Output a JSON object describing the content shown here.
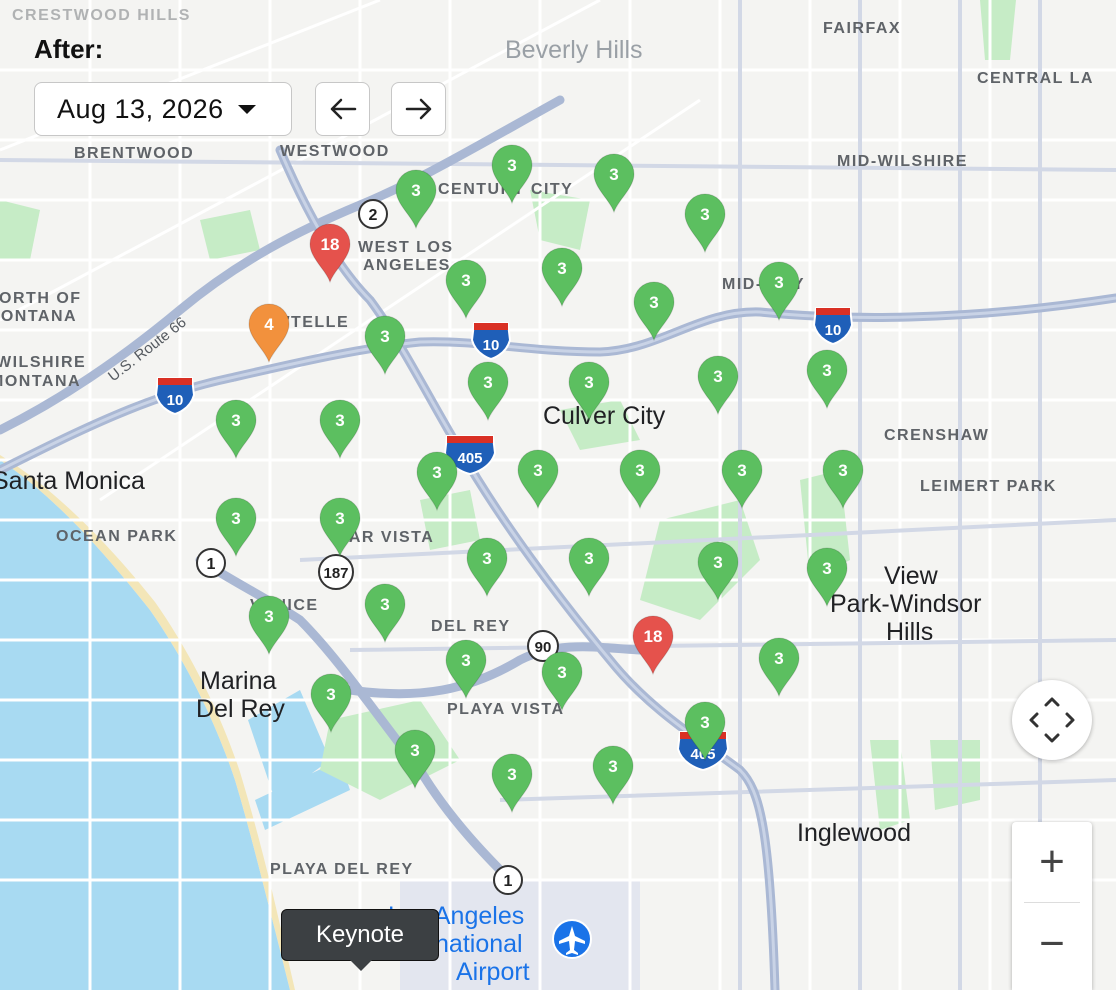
{
  "filter": {
    "label": "After:",
    "date": "Aug 13, 2026",
    "prev_icon": "arrow-left-icon",
    "next_icon": "arrow-right-icon"
  },
  "map": {
    "water_color": "#a8daf2",
    "park_color": "#c6ecc6",
    "road_color": "#aab8d4",
    "neighborhoods": [
      "CRESTWOOD HILLS",
      "FAIRFAX",
      "CENTRAL LA",
      "BRENTWOOD",
      "WESTWOOD",
      "MID-WILSHIRE",
      "WEST LOS",
      "ANGELES",
      "CENTURY CITY",
      "SAWTELLE",
      "MID-CITY",
      "NORTH OF",
      "MONTANA",
      "WILSHIRE",
      "MONTANA",
      "CRENSHAW",
      "LEIMERT PARK",
      "OCEAN PARK",
      "MAR VISTA",
      "VENICE",
      "DEL REY",
      "PLAYA VISTA",
      "PLAYA DEL REY"
    ],
    "cities": [
      "Beverly Hills",
      "Culver City",
      "Santa Monica",
      "View",
      "Park-Windsor",
      "Hills",
      "Marina",
      "Del Rey",
      "Inglewood",
      "Los Angeles",
      "International",
      "Airport"
    ],
    "road_labels": [
      "U.S. Route 66"
    ],
    "shields": [
      "2",
      "10",
      "10",
      "10",
      "405",
      "405",
      "1",
      "187",
      "90",
      "1"
    ]
  },
  "markers": [
    {
      "count": "3",
      "color": "#5cbf60"
    },
    {
      "count": "3",
      "color": "#5cbf60"
    },
    {
      "count": "3",
      "color": "#5cbf60"
    },
    {
      "count": "3",
      "color": "#5cbf60"
    },
    {
      "count": "18",
      "color": "#e5524c"
    },
    {
      "count": "3",
      "color": "#5cbf60"
    },
    {
      "count": "3",
      "color": "#5cbf60"
    },
    {
      "count": "3",
      "color": "#5cbf60"
    },
    {
      "count": "3",
      "color": "#5cbf60"
    },
    {
      "count": "4",
      "color": "#f2913d"
    },
    {
      "count": "3",
      "color": "#5cbf60"
    },
    {
      "count": "3",
      "color": "#5cbf60"
    },
    {
      "count": "3",
      "color": "#5cbf60"
    },
    {
      "count": "3",
      "color": "#5cbf60"
    },
    {
      "count": "3",
      "color": "#5cbf60"
    },
    {
      "count": "3",
      "color": "#5cbf60"
    },
    {
      "count": "3",
      "color": "#5cbf60"
    },
    {
      "count": "3",
      "color": "#5cbf60"
    },
    {
      "count": "3",
      "color": "#5cbf60"
    },
    {
      "count": "3",
      "color": "#5cbf60"
    },
    {
      "count": "3",
      "color": "#5cbf60"
    },
    {
      "count": "3",
      "color": "#5cbf60"
    },
    {
      "count": "3",
      "color": "#5cbf60"
    },
    {
      "count": "3",
      "color": "#5cbf60"
    },
    {
      "count": "3",
      "color": "#5cbf60"
    },
    {
      "count": "3",
      "color": "#5cbf60"
    },
    {
      "count": "3",
      "color": "#5cbf60"
    },
    {
      "count": "3",
      "color": "#5cbf60"
    },
    {
      "count": "3",
      "color": "#5cbf60"
    },
    {
      "count": "3",
      "color": "#5cbf60"
    },
    {
      "count": "18",
      "color": "#e5524c"
    },
    {
      "count": "3",
      "color": "#5cbf60"
    },
    {
      "count": "3",
      "color": "#5cbf60"
    },
    {
      "count": "3",
      "color": "#5cbf60"
    },
    {
      "count": "3",
      "color": "#5cbf60"
    },
    {
      "count": "3",
      "color": "#5cbf60"
    },
    {
      "count": "3",
      "color": "#5cbf60"
    },
    {
      "count": "3",
      "color": "#5cbf60"
    },
    {
      "count": "3",
      "color": "#5cbf60"
    },
    {
      "count": "3",
      "color": "#5cbf60"
    },
    {
      "count": "3",
      "color": "#5cbf60"
    }
  ],
  "controls": {
    "recenter_icon": "recenter-arrows-icon",
    "zoom_in": "+",
    "zoom_out": "−"
  },
  "tooltip": {
    "text": "Keynote"
  },
  "airport_icon": "airplane-icon"
}
